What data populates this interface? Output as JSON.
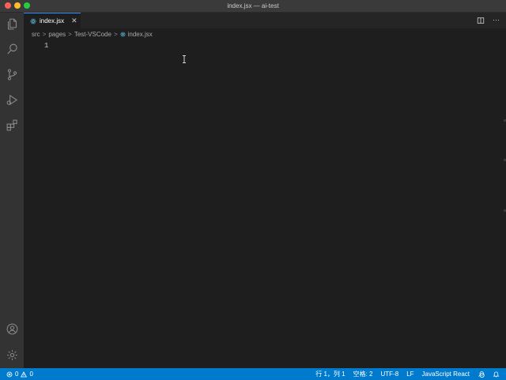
{
  "window": {
    "title": "index.jsx — ai-test"
  },
  "activity_bar": {
    "items": [
      {
        "name": "explorer-icon"
      },
      {
        "name": "search-icon"
      },
      {
        "name": "source-control-icon"
      },
      {
        "name": "run-debug-icon"
      },
      {
        "name": "extensions-icon"
      },
      {
        "name": "account-icon"
      },
      {
        "name": "manage-gear-icon"
      }
    ]
  },
  "tabs": [
    {
      "label": "index.jsx",
      "icon": "react-file-icon",
      "active": true,
      "close": "✕"
    }
  ],
  "tab_actions": {
    "split": "split-editor-icon",
    "more": "···"
  },
  "breadcrumb": {
    "parts": [
      "src",
      "pages",
      "Test-VSCode",
      "index.jsx"
    ],
    "separator": ">"
  },
  "editor": {
    "line_numbers": [
      "1"
    ]
  },
  "status_bar": {
    "errors": "0",
    "warnings": "0",
    "position": "行 1，列 1",
    "indent": "空格: 2",
    "encoding": "UTF-8",
    "eol": "LF",
    "language": "JavaScript React"
  },
  "colors": {
    "accent": "#007acc",
    "react_icon": "#519aba"
  }
}
